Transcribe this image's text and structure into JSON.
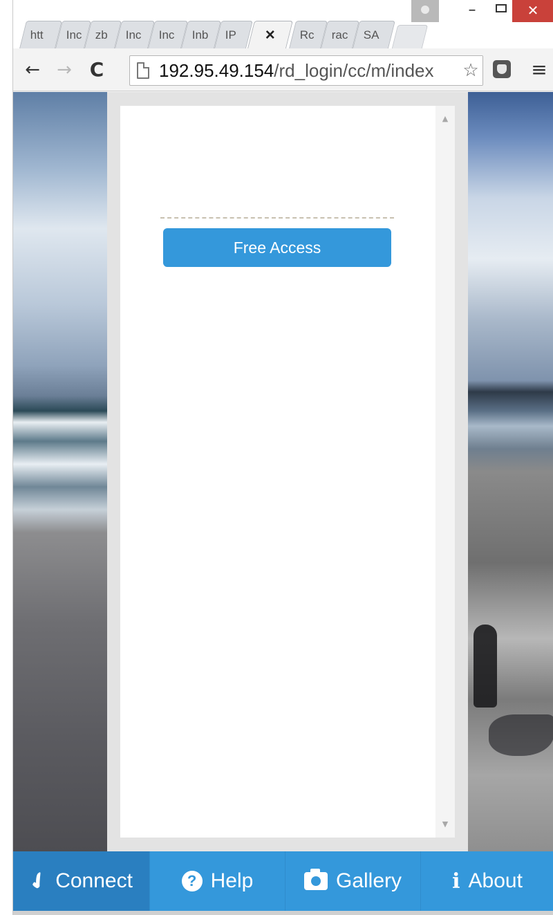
{
  "browser": {
    "tabs": [
      {
        "label": "htt",
        "active": false
      },
      {
        "label": "Inc",
        "active": false
      },
      {
        "label": "zb",
        "active": false
      },
      {
        "label": "Inc",
        "active": false
      },
      {
        "label": "Inc",
        "active": false
      },
      {
        "label": "Inb",
        "active": false
      },
      {
        "label": "IP",
        "active": false
      },
      {
        "label": "×",
        "active": true
      },
      {
        "label": "Rc",
        "active": false
      },
      {
        "label": "rac",
        "active": false
      },
      {
        "label": "SA",
        "active": false
      }
    ],
    "window_controls": {
      "minimize": "–",
      "close": "✕"
    },
    "toolbar": {
      "back": "←",
      "forward": "→",
      "reload": "C",
      "menu": "≡"
    },
    "address": {
      "host": "192.95.49.154",
      "path": "/rd_login/cc/m/index",
      "star": "☆"
    }
  },
  "page": {
    "free_access_label": "Free Access",
    "scroll_up": "▲",
    "scroll_down": "▼"
  },
  "bottom_nav": [
    {
      "label": "Connect",
      "icon": "plug-icon",
      "glyph": "✔",
      "active": true
    },
    {
      "label": "Help",
      "icon": "help-icon",
      "glyph": "?",
      "active": false
    },
    {
      "label": "Gallery",
      "icon": "camera-icon",
      "glyph": "",
      "active": false
    },
    {
      "label": "About",
      "icon": "info-icon",
      "glyph": "i",
      "active": false
    }
  ],
  "colors": {
    "accent": "#3498db",
    "accent_active": "#2a7fc0",
    "close_button": "#c9413a"
  }
}
